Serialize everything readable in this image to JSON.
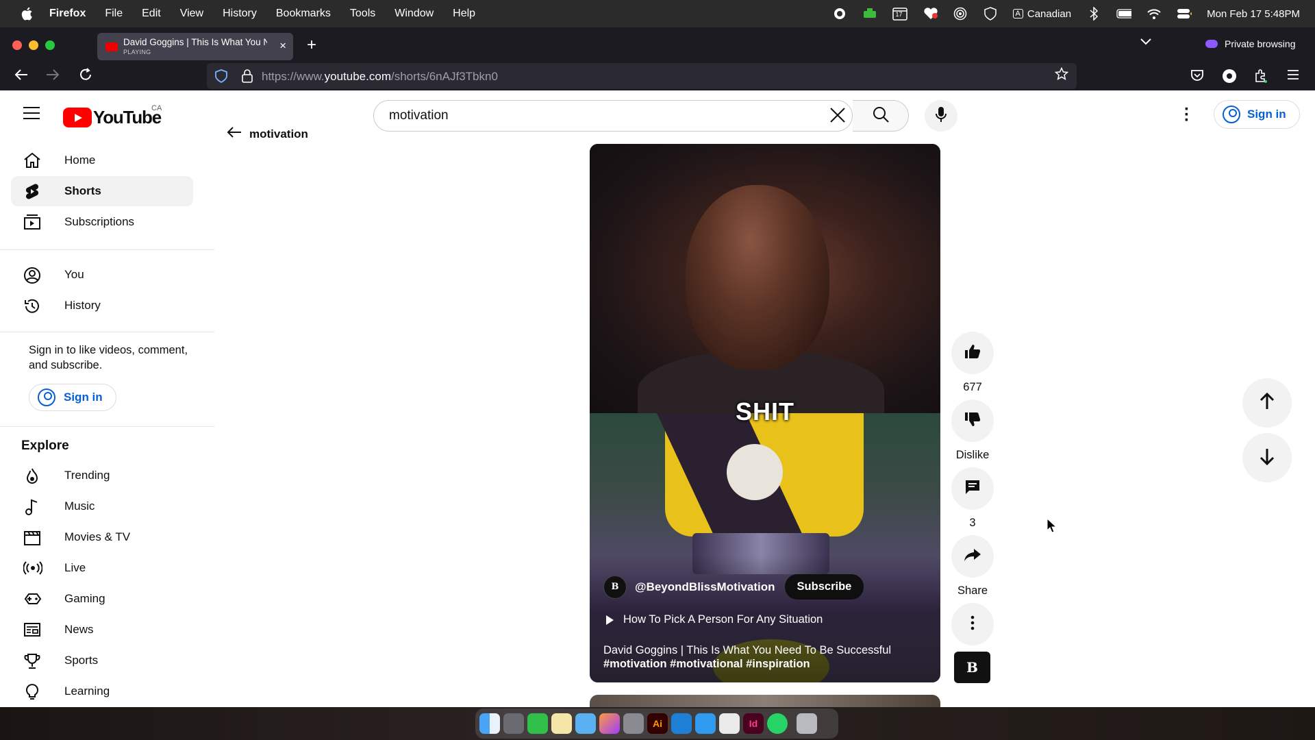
{
  "menubar": {
    "app": "Firefox",
    "items": [
      "File",
      "Edit",
      "View",
      "History",
      "Bookmarks",
      "Tools",
      "Window",
      "Help"
    ],
    "input_source": "Canadian",
    "input_key": "A",
    "calendar_day": "17",
    "datetime": "Mon Feb 17  5:48PM"
  },
  "browser": {
    "tab_title": "David Goggins | This Is What You Need To Be Successful",
    "tab_status": "PLAYING",
    "url_prefix": "https://www.",
    "url_domain": "youtube.com",
    "url_path": "/shorts/6nAJf3Tbkn0",
    "private_label": "Private browsing"
  },
  "youtube": {
    "logo_text": "YouTube",
    "region": "CA",
    "search_value": "motivation",
    "sign_in": "Sign in",
    "back_label": "motivation"
  },
  "sidebar": {
    "main": [
      "Home",
      "Shorts",
      "Subscriptions"
    ],
    "you": [
      "You",
      "History"
    ],
    "signin_message": "Sign in to like videos, comment, and subscribe.",
    "signin_button": "Sign in",
    "explore_heading": "Explore",
    "explore": [
      "Trending",
      "Music",
      "Movies & TV",
      "Live",
      "Gaming",
      "News",
      "Sports",
      "Learning"
    ]
  },
  "short": {
    "caption_word": "SHIT",
    "channel_handle": "@BeyondBlissMotivation",
    "channel_avatar_text": "B",
    "subscribe_label": "Subscribe",
    "related_video": "How To Pick A Person For Any Situation",
    "title": "David Goggins | This Is What You Need To Be Successful",
    "hashtags": "#motivation #motivational #inspiration"
  },
  "actions": {
    "likes": "677",
    "dislike_label": "Dislike",
    "comments": "3",
    "share_label": "Share"
  },
  "colors": {
    "youtube_red": "#ff0000",
    "link_blue": "#065fd4",
    "firefox_chrome": "#1c1b22",
    "private_purple": "#9059ff"
  }
}
